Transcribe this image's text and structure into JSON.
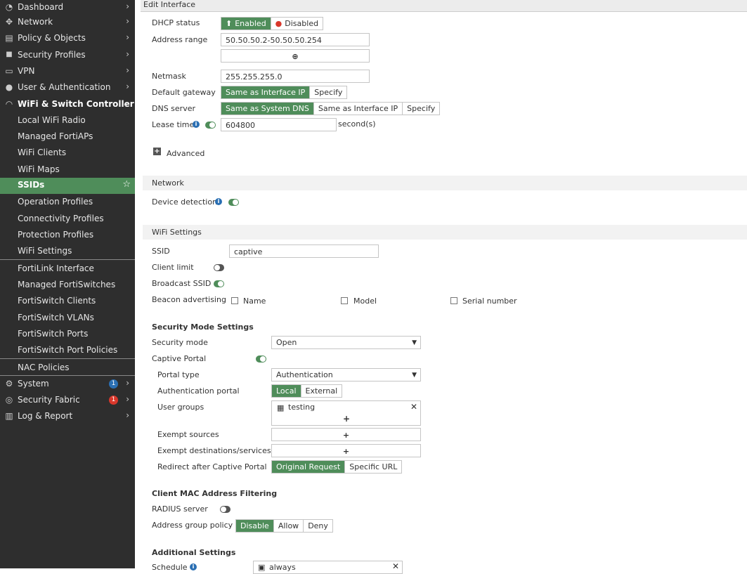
{
  "sidebar": {
    "items": [
      {
        "label": "Dashboard",
        "icon": "dashboard-icon",
        "glyph": "◔"
      },
      {
        "label": "Network",
        "icon": "network-icon",
        "glyph": "✥"
      },
      {
        "label": "Policy & Objects",
        "icon": "policy-icon",
        "glyph": "▤"
      },
      {
        "label": "Security Profiles",
        "icon": "lock-icon",
        "glyph": "🔒"
      },
      {
        "label": "VPN",
        "icon": "monitor-icon",
        "glyph": "▭"
      },
      {
        "label": "User & Authentication",
        "icon": "user-icon",
        "glyph": "●"
      },
      {
        "label": "WiFi & Switch Controller",
        "icon": "wifi-icon",
        "glyph": "◠"
      }
    ],
    "subitems_wifi": [
      "Local WiFi Radio",
      "Managed FortiAPs",
      "WiFi Clients",
      "WiFi Maps",
      "SSIDs",
      "Operation Profiles",
      "Connectivity Profiles",
      "Protection Profiles",
      "WiFi Settings"
    ],
    "subitems_switch": [
      "FortiLink Interface",
      "Managed FortiSwitches",
      "FortiSwitch Clients",
      "FortiSwitch VLANs",
      "FortiSwitch Ports",
      "FortiSwitch Port Policies"
    ],
    "nac": "NAC Policies",
    "bottom": [
      {
        "label": "System",
        "icon": "gear-icon",
        "glyph": "⚙",
        "badge": "1",
        "badge_color": "#2a6fb3"
      },
      {
        "label": "Security Fabric",
        "icon": "fabric-icon",
        "glyph": "◎",
        "badge": "1",
        "badge_color": "#d9372b"
      },
      {
        "label": "Log & Report",
        "icon": "chart-icon",
        "glyph": "▥",
        "badge": "",
        "badge_color": ""
      }
    ]
  },
  "topbar": {
    "title": "Edit Interface"
  },
  "dhcp": {
    "status_label": "DHCP status",
    "enabled": "Enabled",
    "disabled": "Disabled",
    "range_label": "Address range",
    "range_value": "50.50.50.2-50.50.50.254",
    "netmask_label": "Netmask",
    "netmask_value": "255.255.255.0",
    "gateway_label": "Default gateway",
    "gateway_opts": [
      "Same as Interface IP",
      "Specify"
    ],
    "dns_label": "DNS server",
    "dns_opts": [
      "Same as System DNS",
      "Same as Interface IP",
      "Specify"
    ],
    "lease_label": "Lease time",
    "lease_value": "604800",
    "lease_unit": "second(s)",
    "advanced": "Advanced"
  },
  "network": {
    "section": "Network",
    "device_detection": "Device detection"
  },
  "wifi": {
    "section": "WiFi Settings",
    "ssid_label": "SSID",
    "ssid_value": "captive",
    "client_limit": "Client limit",
    "broadcast": "Broadcast SSID",
    "beacon": "Beacon advertising",
    "beacon_opts": [
      "Name",
      "Model",
      "Serial number"
    ]
  },
  "security": {
    "heading": "Security Mode Settings",
    "mode_label": "Security mode",
    "mode_value": "Open",
    "captive_label": "Captive Portal",
    "portal_type_label": "Portal type",
    "portal_type_value": "Authentication",
    "auth_portal_label": "Authentication portal",
    "auth_portal_opts": [
      "Local",
      "External"
    ],
    "user_groups_label": "User groups",
    "user_group": "testing",
    "exempt_src_label": "Exempt sources",
    "exempt_dst_label": "Exempt destinations/services",
    "redirect_label": "Redirect after Captive Portal",
    "redirect_opts": [
      "Original Request",
      "Specific URL"
    ]
  },
  "mac": {
    "heading": "Client MAC Address Filtering",
    "radius_label": "RADIUS server",
    "addr_policy_label": "Address group policy",
    "addr_policy_opts": [
      "Disable",
      "Allow",
      "Deny"
    ]
  },
  "additional": {
    "heading": "Additional Settings",
    "schedule_label": "Schedule",
    "schedule_value": "always"
  }
}
